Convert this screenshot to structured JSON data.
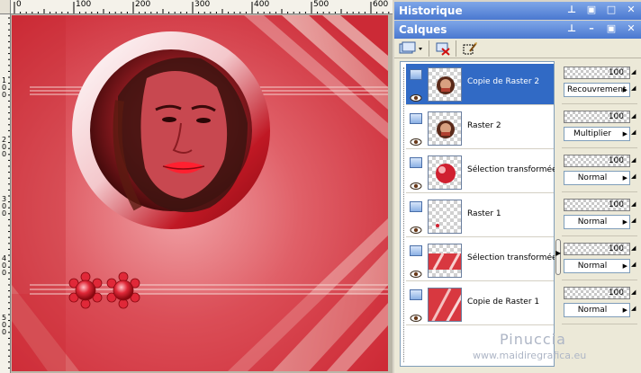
{
  "rulers": {
    "horizontal": [
      "0",
      "100",
      "200",
      "300",
      "400",
      "500",
      "600"
    ],
    "vertical": [
      "1\n0\n0",
      "2\n0\n0",
      "3\n0\n0",
      "4\n0\n0",
      "5\n0\n0"
    ]
  },
  "panels": {
    "history": {
      "title": "Historique"
    },
    "layers": {
      "title": "Calques"
    }
  },
  "layers": [
    {
      "name": "Copie de Raster 2",
      "opacity": "100",
      "blend": "Recouvrement",
      "selected": true,
      "thumb": "face"
    },
    {
      "name": "Raster 2",
      "opacity": "100",
      "blend": "Multiplier",
      "selected": false,
      "thumb": "face"
    },
    {
      "name": "Sélection transformée 1",
      "opacity": "100",
      "blend": "Normal",
      "selected": false,
      "thumb": "red-ball"
    },
    {
      "name": "Raster 1",
      "opacity": "100",
      "blend": "Normal",
      "selected": false,
      "thumb": "dot"
    },
    {
      "name": "Sélection transformée",
      "opacity": "100",
      "blend": "Normal",
      "selected": false,
      "thumb": "red-stripe"
    },
    {
      "name": "Copie de Raster 1",
      "opacity": "100",
      "blend": "Normal",
      "selected": false,
      "thumb": "red-full"
    }
  ],
  "watermark": {
    "name": "Pinuccia",
    "url": "www.maidiregrafica.eu"
  },
  "colors": {
    "title_bar": "#4a78d0",
    "selection": "#316ac5",
    "canvas_red": "#d83840"
  }
}
